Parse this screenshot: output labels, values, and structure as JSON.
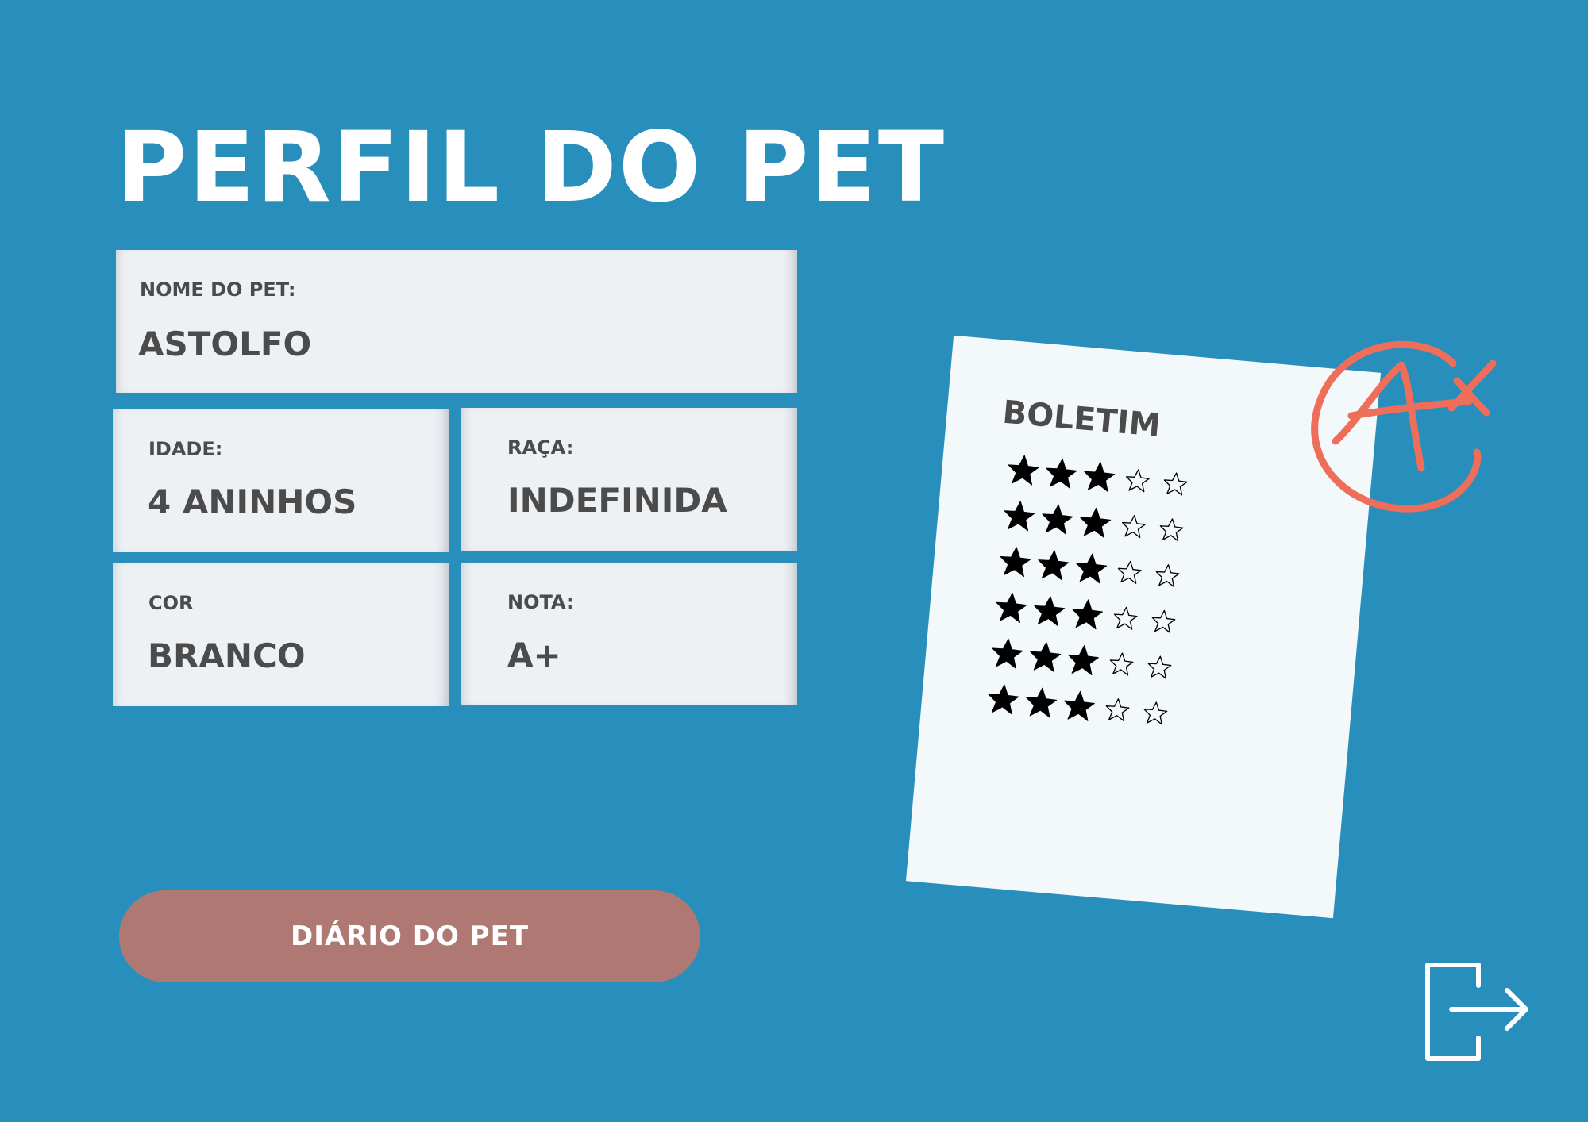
{
  "page": {
    "title": "PERFIL DO PET"
  },
  "fields": {
    "name": {
      "label": "NOME DO PET:",
      "value": "ASTOLFO"
    },
    "age": {
      "label": "IDADE:",
      "value": "4 ANINHOS"
    },
    "breed": {
      "label": "RAÇA:",
      "value": "INDEFINIDA"
    },
    "color": {
      "label": "COR",
      "value": "BRANCO"
    },
    "grade": {
      "label": "NOTA:",
      "value": "A+"
    }
  },
  "report_card": {
    "title": "BOLETIM",
    "ratings": [
      {
        "filled": 3,
        "total": 5
      },
      {
        "filled": 3,
        "total": 5
      },
      {
        "filled": 3,
        "total": 5
      },
      {
        "filled": 3,
        "total": 5
      },
      {
        "filled": 3,
        "total": 5
      },
      {
        "filled": 3,
        "total": 5
      }
    ],
    "grade_stamp": "A+",
    "grade_color": "#ee6e5a"
  },
  "actions": {
    "diary_button": "DIÁRIO DO PET",
    "logout_icon": "logout-icon"
  },
  "colors": {
    "background": "#288ebb",
    "card": "#edf1f4",
    "button": "#b07873",
    "text": "#4b4b4b"
  }
}
